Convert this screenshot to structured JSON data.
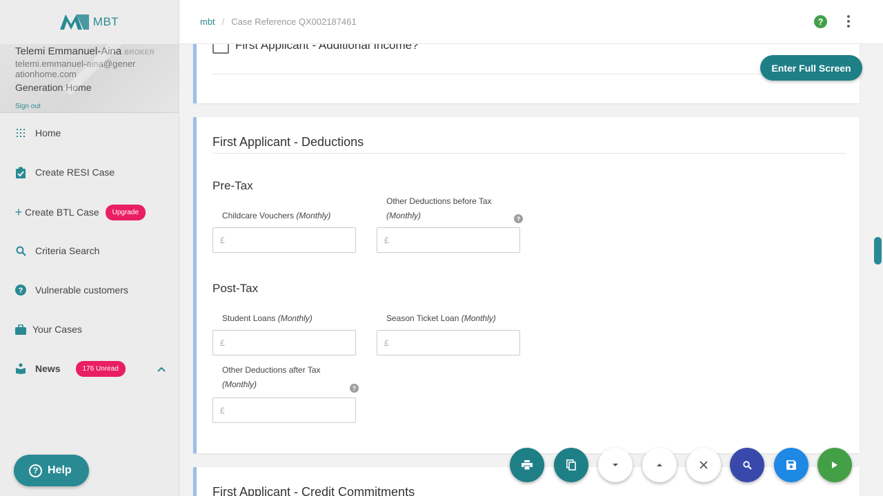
{
  "brand": {
    "name": "MBT",
    "logo_icon": "mbt-logo-icon"
  },
  "user": {
    "name": "Telemi Emmanuel-Aina",
    "role": "BROKER",
    "email": "telemi.emmanuel-aina@generationhome.com",
    "company": "Generation Home",
    "sign_out": "Sign out"
  },
  "nav": {
    "home": "Home",
    "create_resi": "Create RESI Case",
    "create_btl": "Create BTL Case",
    "upgrade_badge": "Upgrade",
    "criteria_search": "Criteria Search",
    "vulnerable": "Vulnerable customers",
    "your_cases": "Your Cases",
    "news": "News",
    "news_badge": "176 Unread"
  },
  "help_button": "Help",
  "breadcrumb": {
    "home": "mbt",
    "separator": "/",
    "current": "Case Reference QX002187461"
  },
  "top_card": {
    "checkbox_label": "First Applicant - Additional Income?"
  },
  "fullscreen_button": "Enter Full Screen",
  "deductions": {
    "title": "First Applicant - Deductions",
    "pre_tax": {
      "title": "Pre-Tax",
      "childcare": {
        "label": "Childcare Vouchers",
        "qualifier": "(Monthly)",
        "placeholder": "£"
      },
      "other_before": {
        "label": "Other Deductions before Tax",
        "qualifier": "(Monthly)",
        "placeholder": "£"
      }
    },
    "post_tax": {
      "title": "Post-Tax",
      "student_loans": {
        "label": "Student Loans",
        "qualifier": "(Monthly)",
        "placeholder": "£"
      },
      "season_ticket": {
        "label": "Season Ticket Loan",
        "qualifier": "(Monthly)",
        "placeholder": "£"
      },
      "other_after": {
        "label": "Other Deductions after Tax",
        "qualifier": "(Monthly)",
        "placeholder": "£"
      }
    }
  },
  "next_section_title": "First Applicant - Credit Commitments",
  "colors": {
    "accent": "#2a8a93",
    "badge": "#e91e63",
    "card_border": "#9bbfe9",
    "search_fab": "#3949ab",
    "save_fab": "#1e88e5",
    "next_fab": "#43a047"
  },
  "fab_icons": [
    "print-icon",
    "copy-icon",
    "collapse-down-icon",
    "collapse-up-icon",
    "close-icon",
    "search-icon",
    "save-icon",
    "play-icon"
  ]
}
